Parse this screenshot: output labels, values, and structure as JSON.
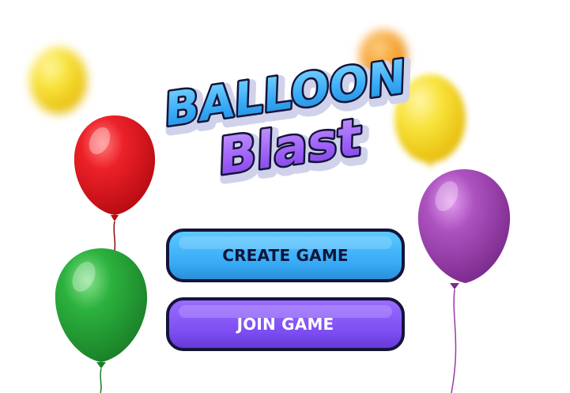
{
  "logo": {
    "line1": "BALLOON",
    "line2": "Blast"
  },
  "buttons": {
    "create_label": "CREATE GAME",
    "join_label": "JOIN GAME"
  },
  "colors": {
    "background": "#ffffff",
    "create_button": "#38b0f8",
    "join_button": "#7d4ff2",
    "button_border": "#14143a",
    "logo_blue": "#35a9f5",
    "logo_purple": "#9b5cf6",
    "logo_outline": "#14143a",
    "balloon_red": "#e3131c",
    "balloon_green": "#25a83a",
    "balloon_purple": "#a347b4",
    "balloon_yellow": "#f7df2a",
    "balloon_orange": "#f5a12a"
  },
  "balloons": [
    {
      "name": "yellow-balloon-left",
      "color": "yellow",
      "blurred": true
    },
    {
      "name": "orange-balloon-top",
      "color": "orange",
      "blurred": true
    },
    {
      "name": "yellow-balloon-right",
      "color": "yellow",
      "blurred": true
    },
    {
      "name": "red-balloon",
      "color": "red",
      "blurred": false
    },
    {
      "name": "green-balloon",
      "color": "green",
      "blurred": false
    },
    {
      "name": "purple-balloon",
      "color": "purple",
      "blurred": false
    }
  ]
}
